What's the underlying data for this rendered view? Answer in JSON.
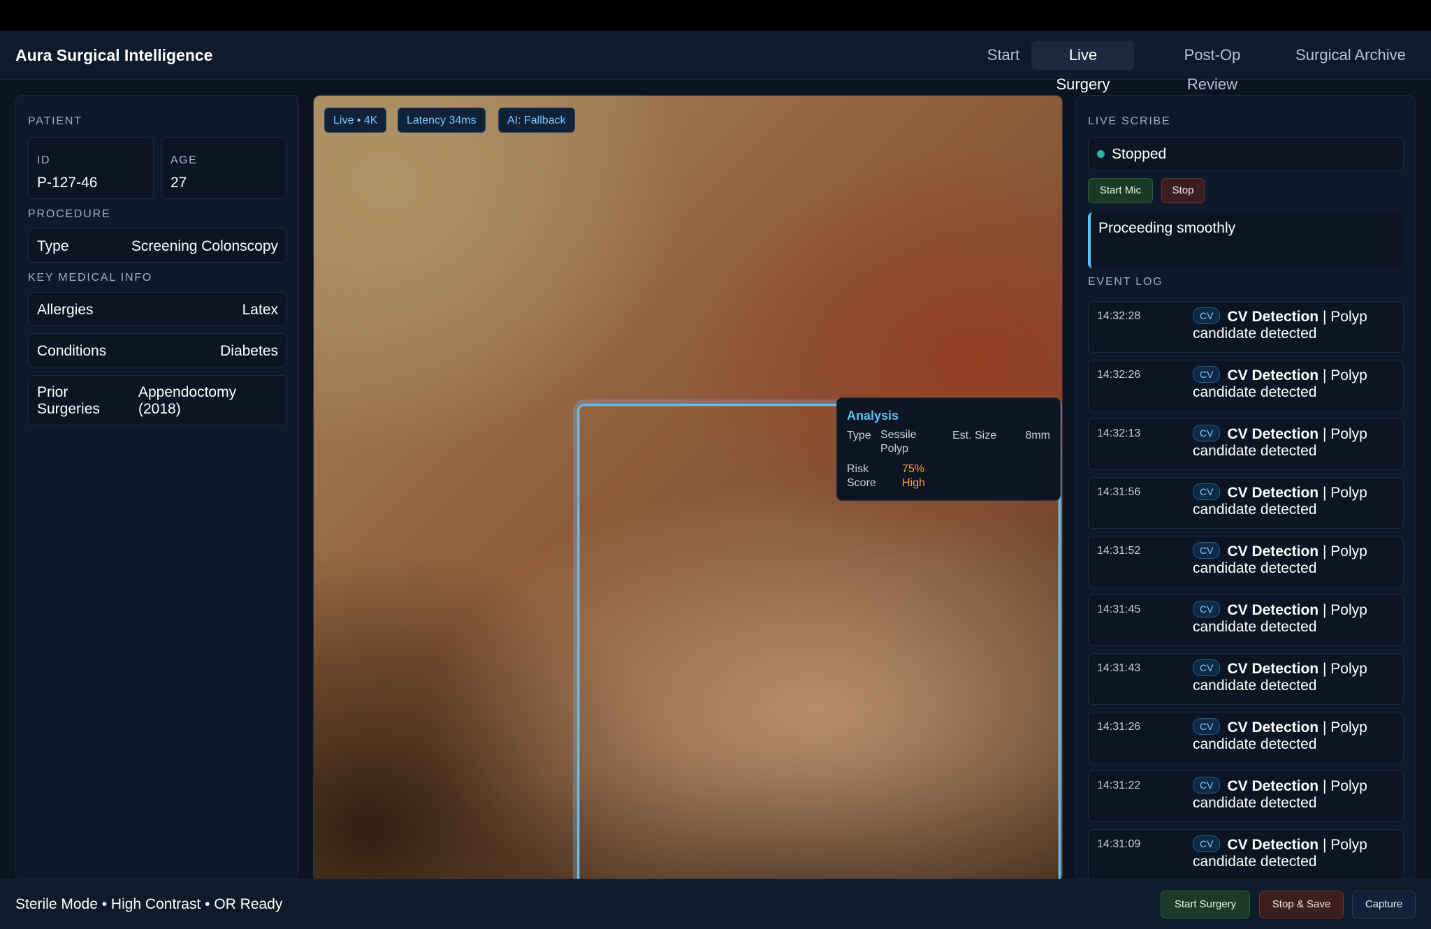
{
  "app": {
    "title": "Aura Surgical Intelligence"
  },
  "nav": {
    "tabs": [
      "Start",
      "Live Surgery",
      "Post-Op Review",
      "Surgical Archive"
    ],
    "active": "Live Surgery"
  },
  "patient": {
    "section_label": "PATIENT",
    "id_label": "ID",
    "id": "P-127-46",
    "age_label": "AGE",
    "age": "27",
    "procedure_label": "PROCEDURE",
    "type_label": "Type",
    "type": "Screening Colonscopy",
    "key_info_label": "KEY MEDICAL INFO",
    "allergies_label": "Allergies",
    "allergies": "Latex",
    "conditions_label": "Conditions",
    "conditions": "Diabetes",
    "prior_label_1": "Prior",
    "prior_label_2": "Surgeries",
    "prior_value_1": "Appendoctomy",
    "prior_value_2": "(2018)"
  },
  "video": {
    "badges": [
      "Live • 4K",
      "Latency 34ms",
      "AI: Fallback"
    ],
    "analysis": {
      "title": "Analysis",
      "type_label": "Type",
      "type_value_1": "Sessile",
      "type_value_2": "Polyp",
      "size_label": "Est. Size",
      "size_value": "8mm",
      "risk_label_1": "Risk",
      "risk_label_2": "Score",
      "risk_value": "75%",
      "risk_level": "High"
    }
  },
  "scribe": {
    "section_label": "LIVE SCRIBE",
    "status": "Stopped",
    "start_mic_label": "Start Mic",
    "stop_label": "Stop",
    "transcript": "Proceeding smoothly",
    "event_log_label": "EVENT LOG",
    "events": [
      {
        "time": "14:32:28",
        "tag": "CV",
        "title": "CV Detection",
        "detail": "| Polyp candidate detected"
      },
      {
        "time": "14:32:26",
        "tag": "CV",
        "title": "CV Detection",
        "detail": "| Polyp candidate detected"
      },
      {
        "time": "14:32:13",
        "tag": "CV",
        "title": "CV Detection",
        "detail": "| Polyp candidate detected"
      },
      {
        "time": "14:31:56",
        "tag": "CV",
        "title": "CV Detection",
        "detail": "| Polyp candidate detected"
      },
      {
        "time": "14:31:52",
        "tag": "CV",
        "title": "CV Detection",
        "detail": "| Polyp candidate detected"
      },
      {
        "time": "14:31:45",
        "tag": "CV",
        "title": "CV Detection",
        "detail": "| Polyp candidate detected"
      },
      {
        "time": "14:31:43",
        "tag": "CV",
        "title": "CV Detection",
        "detail": "| Polyp candidate detected"
      },
      {
        "time": "14:31:26",
        "tag": "CV",
        "title": "CV Detection",
        "detail": "| Polyp candidate detected"
      },
      {
        "time": "14:31:22",
        "tag": "CV",
        "title": "CV Detection",
        "detail": "| Polyp candidate detected"
      },
      {
        "time": "14:31:09",
        "tag": "CV",
        "title": "CV Detection",
        "detail": "| Polyp candidate detected"
      }
    ]
  },
  "footer": {
    "status": "Sterile Mode • High Contrast • OR Ready",
    "start_surgery_label": "Start Surgery",
    "stop_save_label": "Stop & Save",
    "capture_label": "Capture"
  },
  "colors": {
    "background": "#0b1422",
    "accent": "#5cc0f5",
    "warning": "#f5a623",
    "start_button": "#1c3a2a",
    "stop_button": "#3d1f20"
  }
}
